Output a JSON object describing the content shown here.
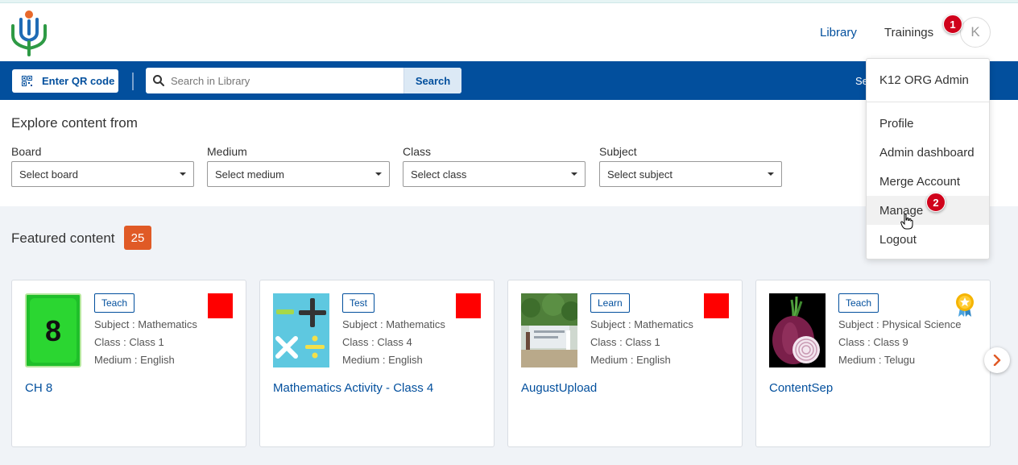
{
  "header": {
    "nav": {
      "library": "Library",
      "trainings": "Trainings"
    },
    "avatar_initial": "K",
    "steps": {
      "one": "1",
      "two": "2"
    }
  },
  "toolbar": {
    "qr_label": "Enter QR code",
    "search_placeholder": "Search in Library",
    "search_button": "Search",
    "right_text_partial": "Se"
  },
  "filters": {
    "title": "Explore content from",
    "items": [
      {
        "label": "Board",
        "value": "Select board"
      },
      {
        "label": "Medium",
        "value": "Select medium"
      },
      {
        "label": "Class",
        "value": "Select class"
      },
      {
        "label": "Subject",
        "value": "Select subject"
      }
    ]
  },
  "featured": {
    "title": "Featured content",
    "count": "25",
    "cards": [
      {
        "type": "Teach",
        "subject": "Subject : Mathematics",
        "class": "Class : Class 1",
        "medium": "Medium : English",
        "title": "CH 8",
        "thumb_text": "8"
      },
      {
        "type": "Test",
        "subject": "Subject : Mathematics",
        "class": "Class : Class 4",
        "medium": "Medium : English",
        "title": "Mathematics Activity - Class 4"
      },
      {
        "type": "Learn",
        "subject": "Subject : Mathematics",
        "class": "Class : Class 1",
        "medium": "Medium : English",
        "title": "AugustUpload"
      },
      {
        "type": "Teach",
        "subject": "Subject : Physical Science",
        "class": "Class : Class 9",
        "medium": "Medium : Telugu",
        "title": "ContentSep"
      }
    ]
  },
  "user_menu": {
    "org": "K12 ORG Admin",
    "items": [
      "Profile",
      "Admin dashboard",
      "Merge Account",
      "Manage",
      "Logout"
    ],
    "hovered": "Manage"
  },
  "colors": {
    "brand_blue": "#024f9d",
    "badge_orange": "#e05a26",
    "step_red": "#d0021b",
    "marker_red": "#ff0000"
  }
}
